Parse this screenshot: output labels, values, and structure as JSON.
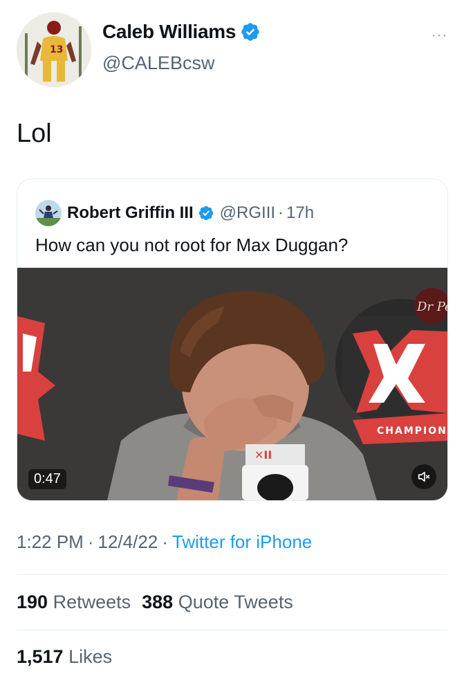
{
  "author": {
    "display_name": "Caleb Williams",
    "handle": "@CALEBcsw",
    "avatar_icon": "profile-photo-football-player",
    "verified_icon": "verified-badge-icon"
  },
  "more_icon": "more-options-icon",
  "more_glyph": "···",
  "tweet": {
    "text": "Lol"
  },
  "quoted": {
    "display_name": "Robert Griffin III",
    "handle": "@RGIII",
    "separator": "·",
    "time": "17h",
    "text": "How can you not root for Max Duggan?",
    "video": {
      "duration": "0:47",
      "thumbnail_subject": "press-conference-player-wiping-eyes",
      "mute_icon": "muted-speaker-icon",
      "backdrop_text": "CHAMPION",
      "backdrop_logo": "Dr Pepper"
    }
  },
  "meta": {
    "time": "1:22 PM",
    "separator": "·",
    "date": "12/4/22",
    "source": "Twitter for iPhone"
  },
  "stats": {
    "retweets_count": "190",
    "retweets_label": "Retweets",
    "quotes_count": "388",
    "quotes_label": "Quote Tweets",
    "likes_count": "1,517",
    "likes_label": "Likes"
  },
  "colors": {
    "accent": "#1d9bf0",
    "secondary_text": "#536471",
    "primary_text": "#0f1419",
    "divider": "#e6ecf0"
  }
}
